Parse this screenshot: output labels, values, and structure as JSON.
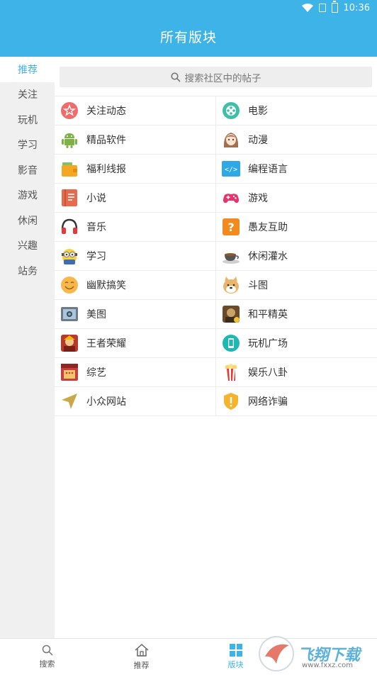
{
  "status": {
    "time": "10:36"
  },
  "header": {
    "title": "所有版块"
  },
  "sidebar": {
    "items": [
      {
        "label": "推荐",
        "active": true
      },
      {
        "label": "关注"
      },
      {
        "label": "玩机"
      },
      {
        "label": "学习"
      },
      {
        "label": "影音"
      },
      {
        "label": "游戏"
      },
      {
        "label": "休闲"
      },
      {
        "label": "兴趣"
      },
      {
        "label": "站务"
      }
    ]
  },
  "search": {
    "placeholder": "搜索社区中的帖子"
  },
  "boards": [
    [
      {
        "label": "关注动态",
        "icon": "star-circle-icon"
      },
      {
        "label": "电影",
        "icon": "film-reel-icon"
      }
    ],
    [
      {
        "label": "精品软件",
        "icon": "android-icon"
      },
      {
        "label": "动漫",
        "icon": "anime-girl-icon"
      }
    ],
    [
      {
        "label": "福利线报",
        "icon": "wallet-icon"
      },
      {
        "label": "编程语言",
        "icon": "code-icon"
      }
    ],
    [
      {
        "label": "小说",
        "icon": "book-icon"
      },
      {
        "label": "游戏",
        "icon": "gamepad-icon"
      }
    ],
    [
      {
        "label": "音乐",
        "icon": "headphones-icon"
      },
      {
        "label": "愚友互助",
        "icon": "question-icon"
      }
    ],
    [
      {
        "label": "学习",
        "icon": "minion-icon"
      },
      {
        "label": "休闲灌水",
        "icon": "coffee-cup-icon"
      }
    ],
    [
      {
        "label": "幽默搞笑",
        "icon": "smiley-icon"
      },
      {
        "label": "斗图",
        "icon": "doge-icon"
      }
    ],
    [
      {
        "label": "美图",
        "icon": "photo-icon"
      },
      {
        "label": "和平精英",
        "icon": "game-avatar-icon"
      }
    ],
    [
      {
        "label": "王者荣耀",
        "icon": "hero-avatar-icon"
      },
      {
        "label": "玩机广场",
        "icon": "phone-icon"
      }
    ],
    [
      {
        "label": "综艺",
        "icon": "stage-icon"
      },
      {
        "label": "娱乐八卦",
        "icon": "popcorn-icon"
      }
    ],
    [
      {
        "label": "小众网站",
        "icon": "navigation-arrow-icon"
      },
      {
        "label": "网络诈骗",
        "icon": "shield-alert-icon"
      }
    ]
  ],
  "tabbar": {
    "items": [
      {
        "label": "搜索",
        "icon": "search-icon"
      },
      {
        "label": "推荐",
        "icon": "home-icon"
      },
      {
        "label": "版块",
        "icon": "grid-icon",
        "active": true
      }
    ]
  },
  "watermark": {
    "text": "飞翔下载",
    "sub": "www.fxxz.com"
  },
  "colors": {
    "accent": "#3db3e8"
  }
}
